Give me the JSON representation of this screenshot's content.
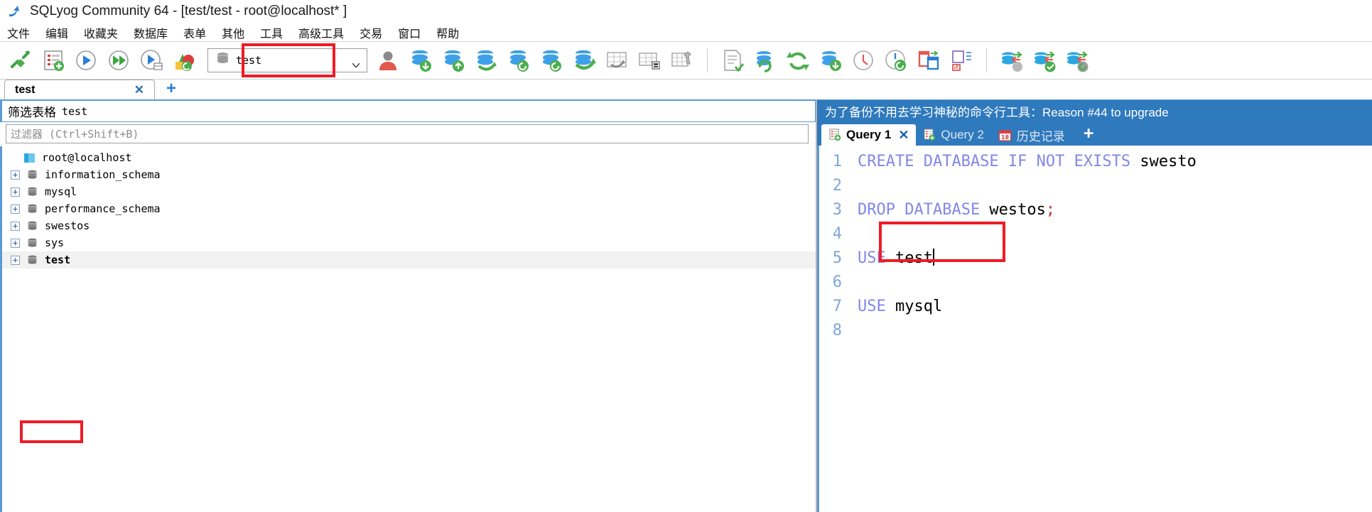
{
  "window": {
    "title": "SQLyog Community 64 - [test/test - root@localhost* ]",
    "app_icon": "dolphin-icon"
  },
  "menubar": {
    "items": [
      {
        "label": "文件",
        "name": "menu-file"
      },
      {
        "label": "编辑",
        "name": "menu-edit"
      },
      {
        "label": "收藏夹",
        "name": "menu-favorites"
      },
      {
        "label": "数据库",
        "name": "menu-database"
      },
      {
        "label": "表单",
        "name": "menu-table"
      },
      {
        "label": "其他",
        "name": "menu-other"
      },
      {
        "label": "工具",
        "name": "menu-tools"
      },
      {
        "label": "高级工具",
        "name": "menu-powertools"
      },
      {
        "label": "交易",
        "name": "menu-transaction"
      },
      {
        "label": "窗口",
        "name": "menu-window"
      },
      {
        "label": "帮助",
        "name": "menu-help"
      }
    ]
  },
  "toolbar": {
    "database_selector": {
      "value": "test",
      "icon": "database-icon",
      "arrow": "chevron-down-icon"
    },
    "buttons": [
      {
        "name": "new-connection-button",
        "icon": "connection-icon"
      },
      {
        "name": "new-query-tab-button",
        "icon": "new-query-icon"
      },
      {
        "name": "execute-query-button",
        "icon": "play-icon"
      },
      {
        "name": "execute-all-queries-button",
        "icon": "fast-forward-icon"
      },
      {
        "name": "execute-query-new-tab-button",
        "icon": "play-table-icon"
      },
      {
        "name": "schema-designer-button",
        "icon": "schema-designer-icon"
      },
      {
        "name": "user-manager-button",
        "icon": "user-icon"
      },
      {
        "name": "import-external-data-button",
        "icon": "db-import-icon"
      },
      {
        "name": "export-database-button",
        "icon": "db-export-icon"
      },
      {
        "name": "backup-database-button",
        "icon": "db-backup-icon"
      },
      {
        "name": "restore-database-button",
        "icon": "db-restore-icon"
      },
      {
        "name": "copy-database-button",
        "icon": "db-copy-icon"
      },
      {
        "name": "sync-database-button",
        "icon": "db-sync-icon"
      },
      {
        "name": "table-diagnostics-button",
        "icon": "table-diag-icon"
      },
      {
        "name": "table-data-button",
        "icon": "table-data-icon"
      },
      {
        "name": "table-tools-button",
        "icon": "table-tools-icon"
      },
      {
        "name": "save-results-button",
        "icon": "document-save-icon"
      },
      {
        "name": "refresh-object-browser-button",
        "icon": "db-refresh-icon"
      },
      {
        "name": "refresh-button",
        "icon": "refresh-icon"
      },
      {
        "name": "flush-database-button",
        "icon": "db-flush-icon"
      },
      {
        "name": "scheduled-backup-button",
        "icon": "clock-icon"
      },
      {
        "name": "scheduled-job-button",
        "icon": "clock-run-icon"
      },
      {
        "name": "split-view-button",
        "icon": "split-view-icon"
      },
      {
        "name": "form-view-button",
        "icon": "form-view-icon"
      },
      {
        "name": "data-sync-button",
        "icon": "data-sync-icon"
      },
      {
        "name": "data-sync-check-button",
        "icon": "data-sync-check-icon"
      },
      {
        "name": "data-sync-refresh-button",
        "icon": "data-sync-refresh-icon"
      }
    ]
  },
  "doc_tabs": {
    "tabs": [
      {
        "label": "test",
        "name": "doc-tab-test",
        "close": "✕"
      }
    ],
    "add_label": "+"
  },
  "left_pane": {
    "filter_header": {
      "cn": "筛选表格",
      "target": "test"
    },
    "filter_input": {
      "placeholder": "过滤器 (Ctrl+Shift+B)",
      "value": ""
    },
    "tree": [
      {
        "label": "root@localhost",
        "level": 0,
        "icon": "host-icon",
        "expander": "",
        "bold": false,
        "selected": false
      },
      {
        "label": "information_schema",
        "level": 1,
        "icon": "database-icon",
        "expander": "+",
        "bold": false,
        "selected": false
      },
      {
        "label": "mysql",
        "level": 1,
        "icon": "database-icon",
        "expander": "+",
        "bold": false,
        "selected": false
      },
      {
        "label": "performance_schema",
        "level": 1,
        "icon": "database-icon",
        "expander": "+",
        "bold": false,
        "selected": false
      },
      {
        "label": "swestos",
        "level": 1,
        "icon": "database-icon",
        "expander": "+",
        "bold": false,
        "selected": false
      },
      {
        "label": "sys",
        "level": 1,
        "icon": "database-icon",
        "expander": "+",
        "bold": false,
        "selected": false
      },
      {
        "label": "test",
        "level": 1,
        "icon": "database-icon",
        "expander": "+",
        "bold": true,
        "selected": true
      }
    ]
  },
  "right_pane": {
    "promo_banner": "为了备份不用去学习神秘的命令行工具：Reason #44 to upgrade",
    "query_tabs": [
      {
        "label": "Query 1",
        "name": "query-tab-1",
        "icon": "new-query-icon",
        "active": true,
        "close": "✕"
      },
      {
        "label": "Query 2",
        "name": "query-tab-2",
        "icon": "new-query-icon",
        "active": false
      },
      {
        "label": "历史记录",
        "name": "query-tab-history",
        "icon": "calendar-icon",
        "calendar_day": "18",
        "active": false
      }
    ],
    "add_tab_label": "+",
    "editor": {
      "line_numbers": [
        "1",
        "2",
        "3",
        "4",
        "5",
        "6",
        "7",
        "8"
      ],
      "lines": [
        {
          "n": 1,
          "keywords": "CREATE DATABASE IF NOT EXISTS",
          "identifier": " swesto",
          "semi": ""
        },
        {
          "n": 2,
          "keywords": "",
          "identifier": "",
          "semi": ""
        },
        {
          "n": 3,
          "keywords": "DROP DATABASE",
          "identifier": " westos",
          "semi": ";"
        },
        {
          "n": 4,
          "keywords": "",
          "identifier": "",
          "semi": ""
        },
        {
          "n": 5,
          "keywords": "USE",
          "identifier": " test",
          "semi": ""
        },
        {
          "n": 6,
          "keywords": "",
          "identifier": "",
          "semi": ""
        },
        {
          "n": 7,
          "keywords": "USE",
          "identifier": " mysql",
          "semi": ""
        },
        {
          "n": 8,
          "keywords": "",
          "identifier": "",
          "semi": ""
        }
      ]
    }
  },
  "annotations": {
    "accent_red": "#ee1c25",
    "boxes": [
      "database-selector",
      "tree-item-test",
      "editor-line-5"
    ]
  }
}
